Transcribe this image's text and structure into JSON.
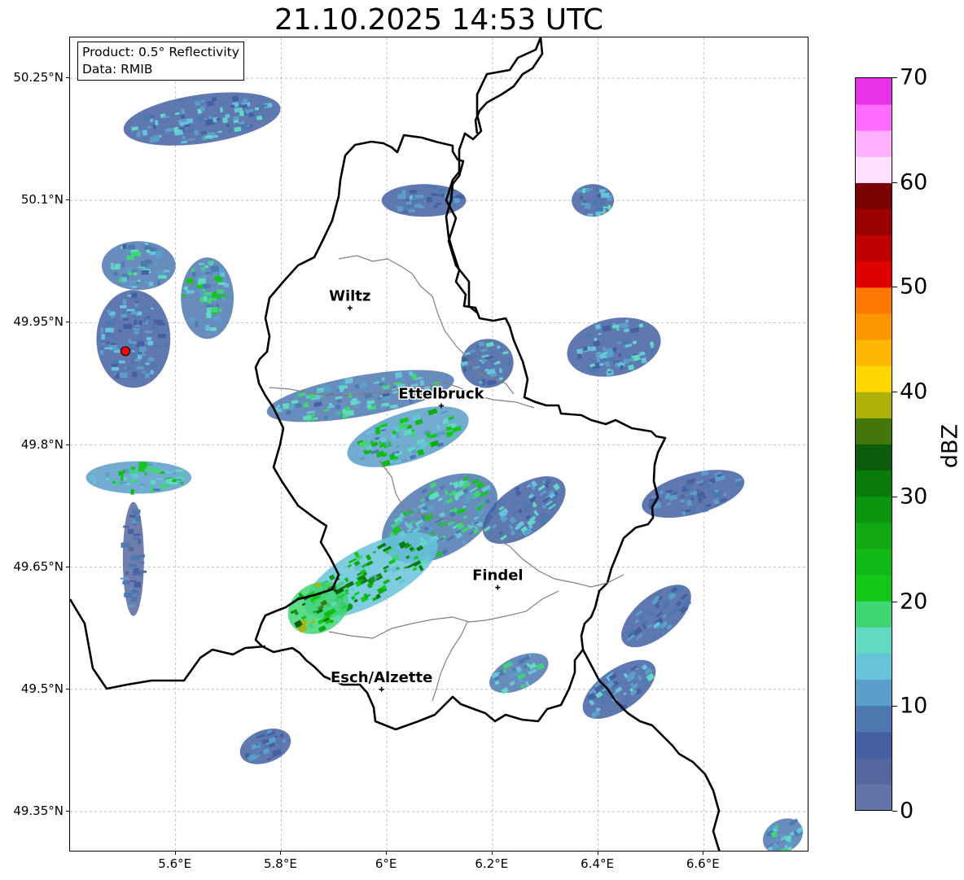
{
  "title": "21.10.2025 14:53 UTC",
  "info": {
    "product": "Product: 0.5° Reflectivity",
    "data": "Data: RMIB"
  },
  "axes": {
    "y_labels": [
      "50.25°N",
      "50.1°N",
      "49.95°N",
      "49.8°N",
      "49.65°N",
      "49.5°N",
      "49.35°N"
    ],
    "y_values": [
      50.25,
      50.1,
      49.95,
      49.8,
      49.65,
      49.5,
      49.35
    ],
    "x_labels": [
      "5.6°E",
      "5.8°E",
      "6°E",
      "6.2°E",
      "6.4°E",
      "6.6°E"
    ],
    "x_values": [
      5.6,
      5.8,
      6.0,
      6.2,
      6.4,
      6.6
    ],
    "lon_range": [
      5.4,
      6.8
    ],
    "lat_range": [
      49.3,
      50.3
    ]
  },
  "cities": [
    {
      "name": "Wiltz",
      "lon": 5.93,
      "lat": 49.968
    },
    {
      "name": "Ettelbruck",
      "lon": 6.103,
      "lat": 49.848
    },
    {
      "name": "Findel",
      "lon": 6.21,
      "lat": 49.625
    },
    {
      "name": "Esch/Alzette",
      "lon": 5.99,
      "lat": 49.5
    }
  ],
  "radar_site": {
    "lon": 5.505,
    "lat": 49.915,
    "color": "#ff0000"
  },
  "colorbar": {
    "unit": "dBZ",
    "min": 0,
    "max": 70,
    "tick_labels": [
      "70",
      "60",
      "50",
      "40",
      "30",
      "20",
      "10",
      "0"
    ],
    "tick_values": [
      70,
      60,
      50,
      40,
      30,
      20,
      10,
      0
    ],
    "colors": [
      "#6574a8",
      "#56679f",
      "#4460a2",
      "#4d79b0",
      "#5a9ec9",
      "#66c3da",
      "#62d9c2",
      "#40d574",
      "#13c719",
      "#11b917",
      "#10a913",
      "#0e950f",
      "#0b7c0b",
      "#0d5b0c",
      "#43770c",
      "#aeb107",
      "#fed601",
      "#feb601",
      "#fe9601",
      "#fe7701",
      "#df0101",
      "#bf0101",
      "#9c0101",
      "#7a0101",
      "#ffe0ff",
      "#ffb1ff",
      "#ff6cff",
      "#e931ea"
    ]
  },
  "echoes": [
    {
      "lon": 5.65,
      "lat": 50.2,
      "rx": 0.15,
      "ry": 0.03,
      "dbz": 12,
      "angle": -8
    },
    {
      "lon": 5.53,
      "lat": 50.02,
      "rx": 0.07,
      "ry": 0.03,
      "dbz": 14,
      "angle": 0
    },
    {
      "lon": 5.66,
      "lat": 49.98,
      "rx": 0.05,
      "ry": 0.05,
      "dbz": 16,
      "angle": 0
    },
    {
      "lon": 5.52,
      "lat": 49.93,
      "rx": 0.07,
      "ry": 0.06,
      "dbz": 10,
      "angle": 0
    },
    {
      "lon": 5.53,
      "lat": 49.76,
      "rx": 0.1,
      "ry": 0.02,
      "dbz": 18,
      "angle": 0
    },
    {
      "lon": 5.52,
      "lat": 49.66,
      "rx": 0.02,
      "ry": 0.07,
      "dbz": 8,
      "angle": 0
    },
    {
      "lon": 5.95,
      "lat": 49.86,
      "rx": 0.18,
      "ry": 0.025,
      "dbz": 14,
      "angle": -10
    },
    {
      "lon": 6.04,
      "lat": 49.81,
      "rx": 0.12,
      "ry": 0.03,
      "dbz": 18,
      "angle": -18
    },
    {
      "lon": 6.19,
      "lat": 49.9,
      "rx": 0.05,
      "ry": 0.03,
      "dbz": 12,
      "angle": -12
    },
    {
      "lon": 6.1,
      "lat": 49.71,
      "rx": 0.12,
      "ry": 0.045,
      "dbz": 16,
      "angle": -30
    },
    {
      "lon": 5.97,
      "lat": 49.64,
      "rx": 0.14,
      "ry": 0.035,
      "dbz": 24,
      "angle": -28
    },
    {
      "lon": 5.87,
      "lat": 49.6,
      "rx": 0.06,
      "ry": 0.03,
      "dbz": 30,
      "angle": -28
    },
    {
      "lon": 6.26,
      "lat": 49.72,
      "rx": 0.09,
      "ry": 0.03,
      "dbz": 12,
      "angle": -35
    },
    {
      "lon": 6.43,
      "lat": 49.92,
      "rx": 0.09,
      "ry": 0.035,
      "dbz": 12,
      "angle": -12
    },
    {
      "lon": 6.58,
      "lat": 49.74,
      "rx": 0.1,
      "ry": 0.025,
      "dbz": 9,
      "angle": -15
    },
    {
      "lon": 6.51,
      "lat": 49.59,
      "rx": 0.08,
      "ry": 0.025,
      "dbz": 9,
      "angle": -40
    },
    {
      "lon": 6.44,
      "lat": 49.5,
      "rx": 0.08,
      "ry": 0.025,
      "dbz": 12,
      "angle": -35
    },
    {
      "lon": 6.25,
      "lat": 49.52,
      "rx": 0.06,
      "ry": 0.02,
      "dbz": 15,
      "angle": -25
    },
    {
      "lon": 5.77,
      "lat": 49.43,
      "rx": 0.05,
      "ry": 0.02,
      "dbz": 9,
      "angle": -20
    },
    {
      "lon": 6.07,
      "lat": 50.1,
      "rx": 0.08,
      "ry": 0.02,
      "dbz": 9,
      "angle": 0
    },
    {
      "lon": 6.39,
      "lat": 50.1,
      "rx": 0.04,
      "ry": 0.02,
      "dbz": 12,
      "angle": 0
    },
    {
      "lon": 6.75,
      "lat": 49.32,
      "rx": 0.04,
      "ry": 0.02,
      "dbz": 14,
      "angle": -30
    }
  ]
}
